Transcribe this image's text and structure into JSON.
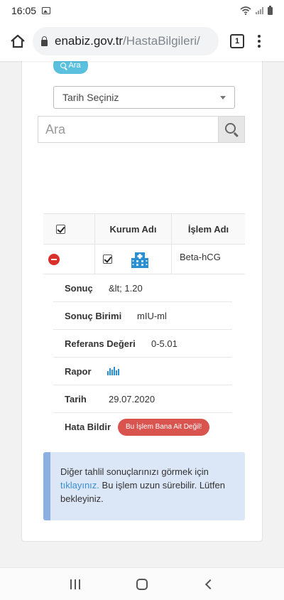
{
  "status_bar": {
    "time": "16:05"
  },
  "browser": {
    "url_host": "enabiz.gov.tr",
    "url_path": "/HastaBilgileri/",
    "tab_count": "1"
  },
  "filters": {
    "ara_label": "Ara",
    "date_select_value": "Tarih Seçiniz",
    "search_placeholder": "Ara"
  },
  "table": {
    "headers": [
      "",
      "Kurum Adı",
      "İşlem Adı"
    ],
    "row": {
      "islem_adi": "Beta-hCG"
    },
    "details": {
      "sonuc_label": "Sonuç",
      "sonuc_value": "&lt; 1.20",
      "birim_label": "Sonuç Birimi",
      "birim_value": "mIU-ml",
      "referans_label": "Referans Değeri",
      "referans_value": "0-5.01",
      "rapor_label": "Rapor",
      "tarih_label": "Tarih",
      "tarih_value": "29.07.2020",
      "hata_label": "Hata Bildir",
      "hata_button": "Bu İşlem Bana Ait Değil!"
    }
  },
  "alert": {
    "text_before": "Diğer tahlil sonuçlarınızı görmek için",
    "link_text": "tıklayınız.",
    "text_after": "Bu işlem uzun sürebilir. Lütfen bekleyiniz."
  },
  "colors": {
    "info_button": "#5bc0de",
    "danger": "#d9534f",
    "alert_bg": "#dbe6f6",
    "link": "#3a8fd1"
  },
  "icons": [
    "image-icon",
    "wifi-icon",
    "signal-icon",
    "battery-icon",
    "home-icon",
    "lock-icon",
    "menu-dots-icon",
    "search-icon",
    "caret-down-icon",
    "checkbox-icon",
    "minus-circle-icon",
    "hospital-icon",
    "bar-chart-icon",
    "recent-apps-icon",
    "home-circle-icon",
    "back-icon"
  ]
}
